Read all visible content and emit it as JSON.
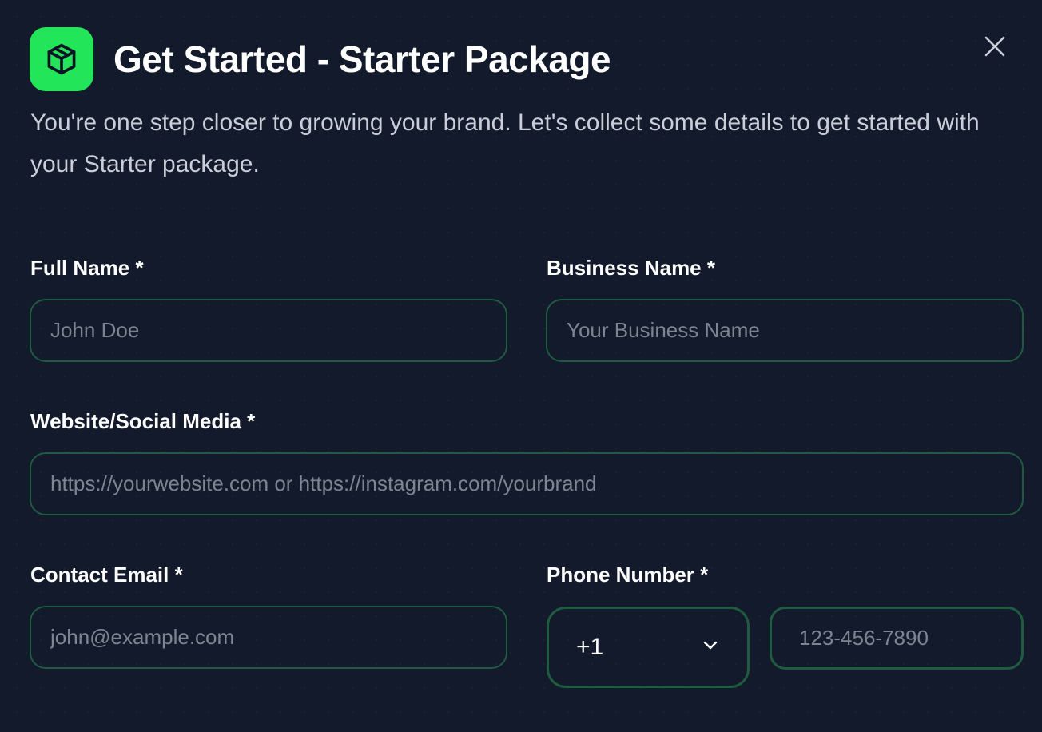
{
  "header": {
    "title": "Get Started - Starter Package",
    "icon": "package-box-icon",
    "accent_color": "#22e55a"
  },
  "subtitle": "You're one step closer to growing your brand. Let's collect some details to get started with your Starter package.",
  "form": {
    "full_name": {
      "label": "Full Name *",
      "placeholder": "John Doe"
    },
    "business_name": {
      "label": "Business Name *",
      "placeholder": "Your Business Name"
    },
    "website": {
      "label": "Website/Social Media *",
      "placeholder": "https://yourwebsite.com or https://instagram.com/yourbrand"
    },
    "email": {
      "label": "Contact Email *",
      "placeholder": "john@example.com"
    },
    "phone": {
      "label": "Phone Number *",
      "country_code": "+1",
      "placeholder": "123-456-7890"
    }
  },
  "colors": {
    "background": "#121a2b",
    "field_border": "#1f5c3f",
    "placeholder": "#7d8592"
  }
}
